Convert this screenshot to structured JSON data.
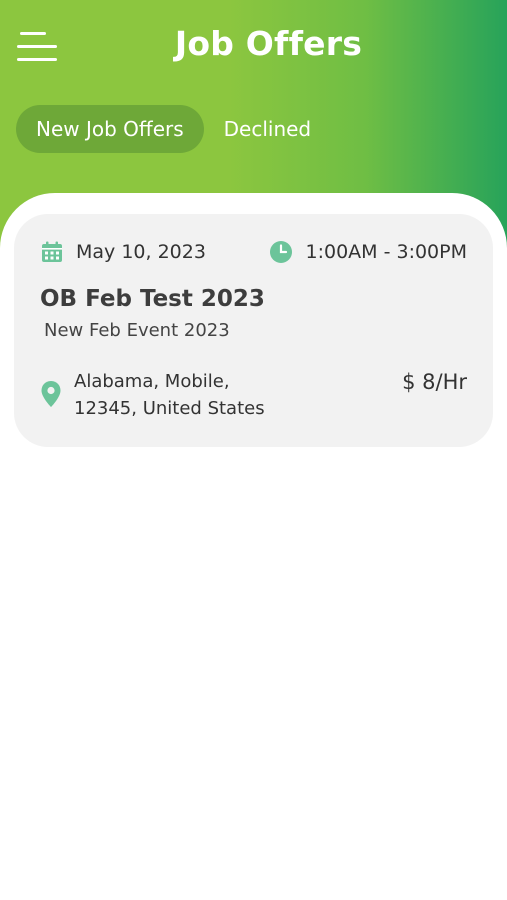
{
  "header": {
    "title": "Job Offers",
    "gradient_start": "#8cc63f",
    "gradient_end": "#27a35a"
  },
  "menu": {
    "icon": "hamburger-menu-icon"
  },
  "tabs": [
    {
      "label": "New Job Offers",
      "active": true
    },
    {
      "label": "Declined",
      "active": false
    }
  ],
  "offers": [
    {
      "date": "May 10, 2023",
      "time": "1:00AM - 3:00PM",
      "title": "OB Feb Test 2023",
      "event": "New Feb Event 2023",
      "location_line1": "Alabama, Mobile,",
      "location_line2": "12345, United States",
      "rate": "$ 8/Hr",
      "icon_color": "#6cc49a"
    }
  ]
}
